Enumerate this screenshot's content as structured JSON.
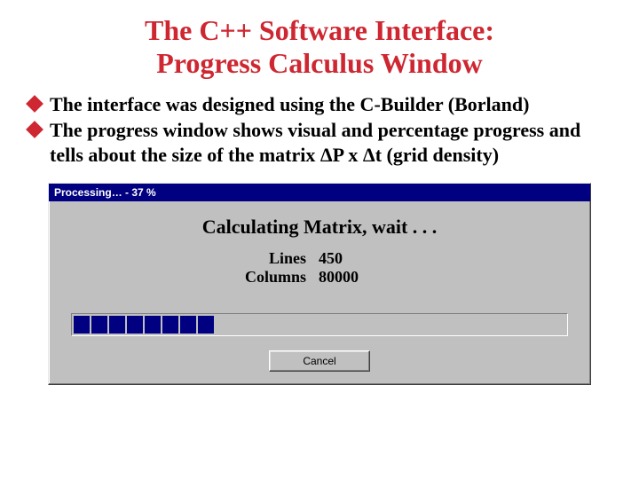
{
  "slide": {
    "title_line1": "The C++ Software Interface:",
    "title_line2": "Progress Calculus Window",
    "bullets": [
      "The interface was designed using the C-Builder (Borland)",
      "The progress window shows visual and percentage progress and tells about the size of the matrix ΔP x Δt (grid density)"
    ]
  },
  "dialog": {
    "titlebar": "Processing…  -  37 %",
    "message": "Calculating Matrix,  wait  . . .",
    "lines_label": "Lines",
    "lines_value": "450",
    "columns_label": "Columns",
    "columns_value": "80000",
    "progress_chunks": 8,
    "cancel_label": "Cancel"
  }
}
